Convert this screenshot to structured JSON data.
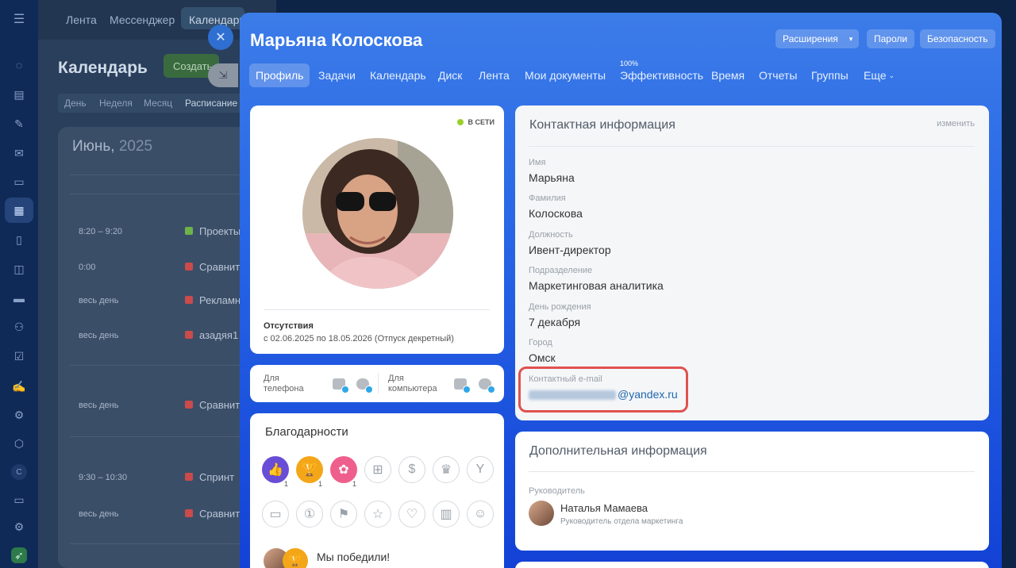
{
  "sidebar_icons": [
    "pulse-icon",
    "feed-icon",
    "tasks-icon",
    "mail-icon",
    "contacts-icon",
    "calendar-icon",
    "docs-icon",
    "chat-icon",
    "card-icon",
    "people-icon",
    "check-icon",
    "sign-icon",
    "robot-icon",
    "box-icon",
    "company-icon",
    "terminal-icon",
    "settings-icon",
    "rocket-icon"
  ],
  "company_letter": "С",
  "bg": {
    "tabs": [
      "Лента",
      "Мессенджер",
      "Календарь"
    ],
    "title": "Календарь",
    "create": "Создать",
    "views": [
      "День",
      "Неделя",
      "Месяц",
      "Расписание"
    ],
    "month": "Июнь,",
    "year": "2025",
    "events": [
      {
        "time": "8:20 – 9:20",
        "name": "Проекты",
        "color": "#6db34a"
      },
      {
        "time": "0:00",
        "name": "Сравнит",
        "color": "#c94b4b"
      },
      {
        "time": "весь день",
        "name": "Рекламн",
        "color": "#c94b4b"
      },
      {
        "time": "весь день",
        "name": "азадяя1",
        "color": "#c94b4b"
      },
      {
        "time": "весь день",
        "name": "Сравнит",
        "color": "#c94b4b"
      },
      {
        "time": "9:30 – 10:30",
        "name": "Спринт",
        "color": "#c94b4b"
      },
      {
        "time": "весь день",
        "name": "Сравнит",
        "color": "#c94b4b"
      }
    ]
  },
  "profile": {
    "name": "Марьяна Колоскова",
    "header_buttons": {
      "extensions": "Расширения",
      "passwords": "Пароли",
      "security": "Безопасность"
    },
    "tabs": [
      "Профиль",
      "Задачи",
      "Календарь",
      "Диск",
      "Лента",
      "Мои документы",
      "Эффективность",
      "Время",
      "Отчеты",
      "Группы",
      "Еще"
    ],
    "efficiency_badge": "100%",
    "online": "В СЕТИ",
    "absence_title": "Отсутствия",
    "absence_text": "с 02.06.2025 по 18.05.2026 (Отпуск декретный)",
    "apps": {
      "phone": "Для телефона",
      "computer": "Для компьютера"
    },
    "thanks_title": "Благодарности",
    "badges_row1": [
      {
        "icon": "thumbs-up-icon",
        "glyph": "👍",
        "bg": "#6a4dd6",
        "count": "1"
      },
      {
        "icon": "trophy-icon",
        "glyph": "🏆",
        "bg": "#f4a619",
        "count": "1"
      },
      {
        "icon": "flower-icon",
        "glyph": "✿",
        "bg": "#ef5f8c",
        "count": "1"
      },
      {
        "icon": "gift-icon",
        "glyph": "🎁"
      },
      {
        "icon": "money-icon",
        "glyph": "$"
      },
      {
        "icon": "crown-icon",
        "glyph": "♛"
      },
      {
        "icon": "cocktail-icon",
        "glyph": "🍸"
      }
    ],
    "badges_row2": [
      {
        "icon": "cake-icon",
        "glyph": "🎂"
      },
      {
        "icon": "number-one-icon",
        "glyph": "①"
      },
      {
        "icon": "flag-icon",
        "glyph": "⚑"
      },
      {
        "icon": "star-icon",
        "glyph": "☆"
      },
      {
        "icon": "heart-icon",
        "glyph": "♡"
      },
      {
        "icon": "beer-icon",
        "glyph": "▥"
      },
      {
        "icon": "smile-icon",
        "glyph": "☺"
      }
    ],
    "post_title": "Мы победили!",
    "contact": {
      "title": "Контактная информация",
      "edit": "изменить",
      "fields": [
        {
          "label": "Имя",
          "value": "Марьяна"
        },
        {
          "label": "Фамилия",
          "value": "Колоскова"
        },
        {
          "label": "Должность",
          "value": "Ивент-директор"
        },
        {
          "label": "Подразделение",
          "value": "Маркетинговая аналитика"
        },
        {
          "label": "День рождения",
          "value": "7 декабря"
        },
        {
          "label": "Город",
          "value": "Омск"
        }
      ],
      "email_label": "Контактный e-mail",
      "email_domain": "@yandex.ru"
    },
    "extra": {
      "title": "Дополнительная информация",
      "manager_label": "Руководитель",
      "manager_name": "Наталья Мамаева",
      "manager_position": "Руководитель отдела маркетинга"
    }
  }
}
